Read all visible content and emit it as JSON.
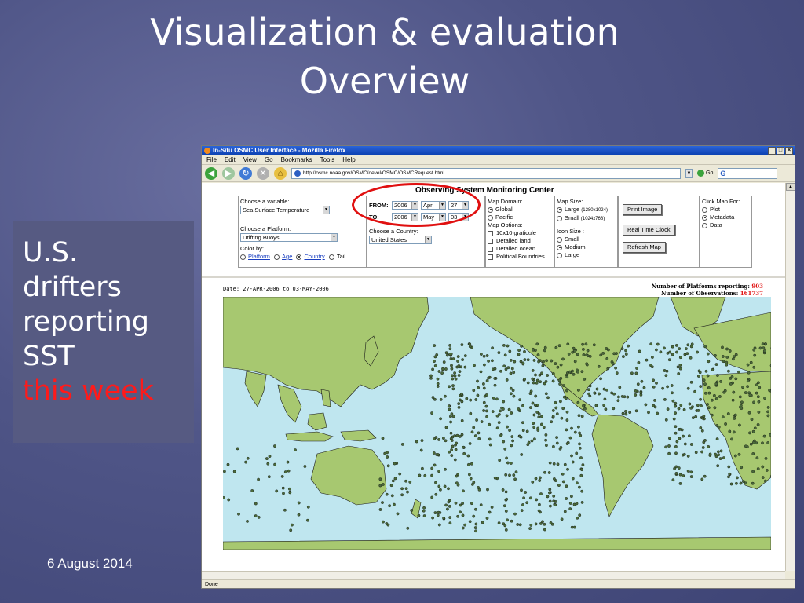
{
  "slide": {
    "title_line1": "Visualization & evaluation",
    "title_line2": "Overview",
    "side_text": [
      "U.S.",
      "drifters",
      "reporting",
      "SST"
    ],
    "side_highlight": "this week",
    "date": "6 August 2014",
    "highlight_color": "#ff1a1a"
  },
  "browser": {
    "window_title": "In-Situ OSMC User Interface - Mozilla Firefox",
    "menu": [
      "File",
      "Edit",
      "View",
      "Go",
      "Bookmarks",
      "Tools",
      "Help"
    ],
    "url": "http://osmc.noaa.gov/OSMC/devel/OSMC/OSMCRequest.html",
    "go_label": "Go",
    "status": "Done"
  },
  "app": {
    "title": "Observing System Monitoring Center",
    "variable": {
      "label": "Choose a variable:",
      "value": "Sea Surface Temperature"
    },
    "platform": {
      "label": "Choose a Platform:",
      "value": "Drifting Buoys"
    },
    "color_by": {
      "label": "Color by:",
      "options": [
        "Platform",
        "Age",
        "Country",
        "Tail"
      ],
      "selected": "Country"
    },
    "from": {
      "label": "FROM:",
      "year": "2006",
      "month": "Apr",
      "day": "27"
    },
    "to": {
      "label": "TO:",
      "year": "2006",
      "month": "May",
      "day": "03"
    },
    "country": {
      "label": "Choose a Country:",
      "value": "United States"
    },
    "map_domain": {
      "label": "Map Domain:",
      "options": [
        "Global",
        "Pacific"
      ],
      "selected": "Global"
    },
    "map_options": {
      "label": "Map Options:",
      "items": [
        "10x10 graticule",
        "Detailed land",
        "Detailed ocean",
        "Political Boundries"
      ]
    },
    "map_size": {
      "label": "Map Size:",
      "options": [
        {
          "name": "Large",
          "dim": "(1280x1024)"
        },
        {
          "name": "Small",
          "dim": "(1024x768)"
        }
      ],
      "selected": "Large"
    },
    "icon_size": {
      "label": "Icon Size :",
      "options": [
        "Small",
        "Medium",
        "Large"
      ],
      "selected": "Medium"
    },
    "buttons": {
      "print": "Print Image",
      "clock": "Real Time Clock",
      "refresh": "Refresh Map"
    },
    "click_map": {
      "label": "Click Map For:",
      "options": [
        "Plot",
        "Metadata",
        "Data"
      ],
      "selected": "Metadata"
    }
  },
  "map": {
    "date_text": "Date: 27-APR-2006 to 03-MAY-2006",
    "platforms_label": "Number of Platforms reporting:",
    "platforms_value": "903",
    "observations_label": "Number of Observations:",
    "observations_value": "161737",
    "ocean_color": "#bfe6ef",
    "land_color": "#a7c870",
    "buoy_color": "#4a6a3a"
  }
}
